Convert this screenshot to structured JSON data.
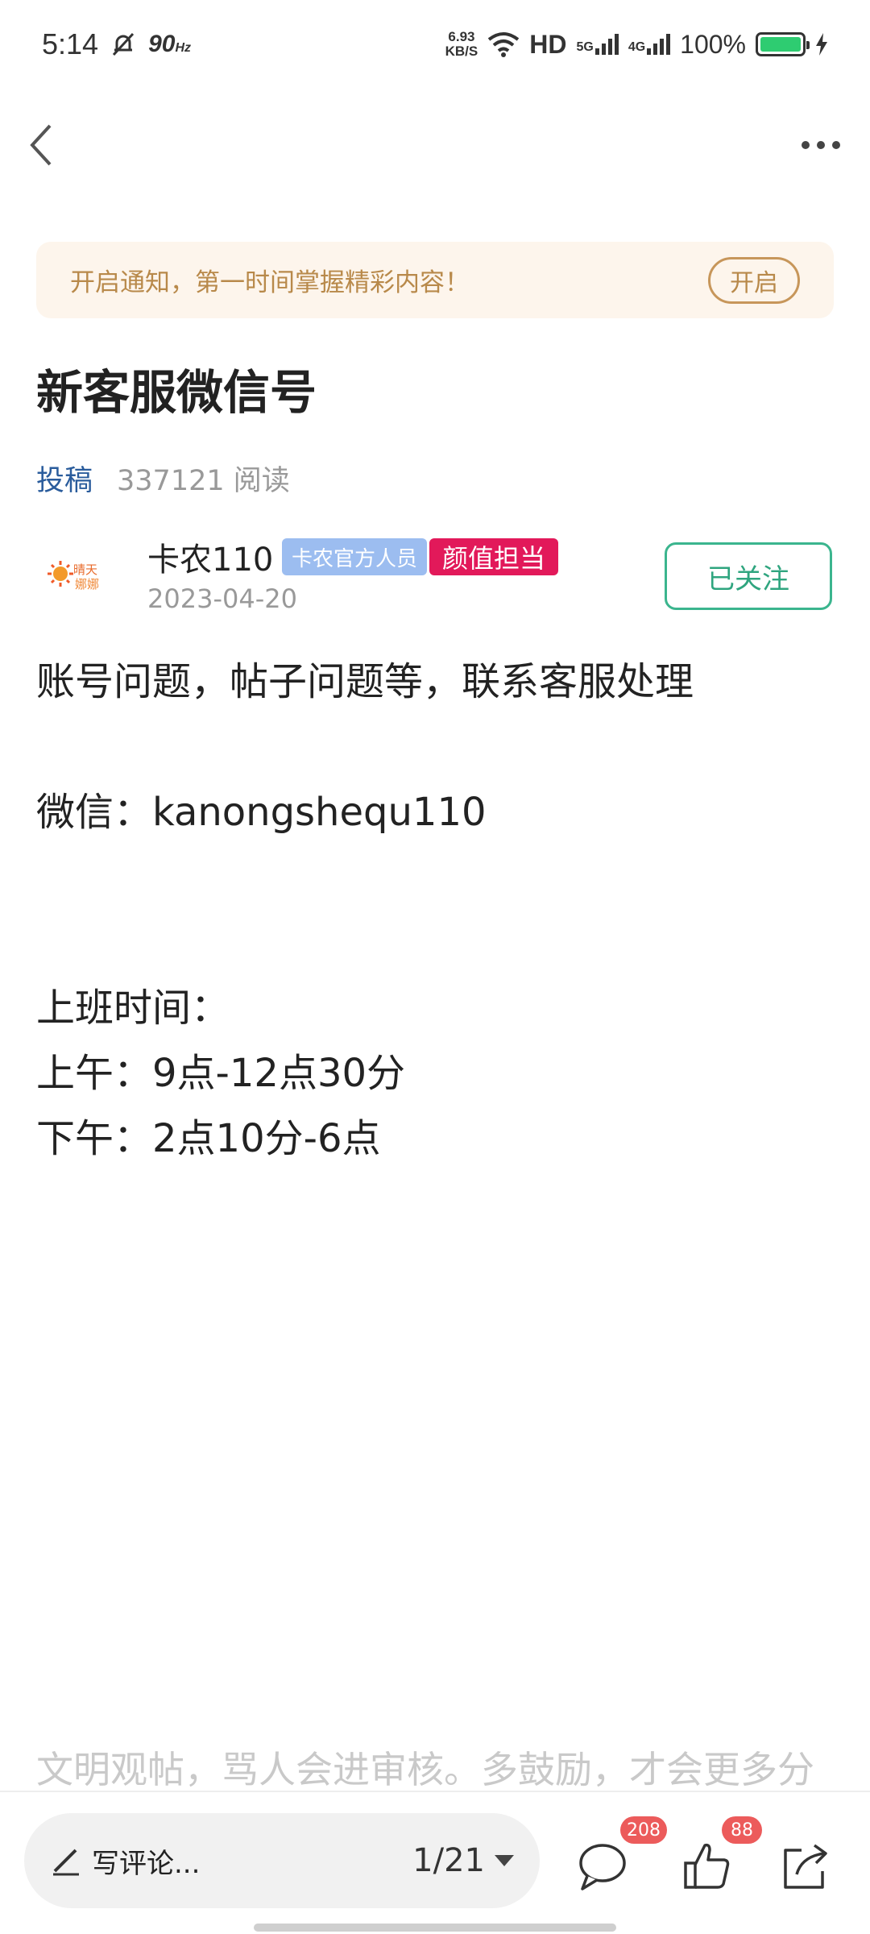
{
  "status_bar": {
    "time": "5:14",
    "refresh": "90",
    "refresh_unit": "Hz",
    "speed_value": "6.93",
    "speed_unit": "KB/S",
    "hd": "HD",
    "net1": "5G",
    "net2": "4G",
    "battery": "100%"
  },
  "notify": {
    "text": "开启通知，第一时间掌握精彩内容！",
    "button": "开启"
  },
  "post": {
    "title": "新客服微信号",
    "category": "投稿",
    "reads": "337121 阅读"
  },
  "author": {
    "name": "卡农110",
    "badge_official": "卡农官方人员",
    "badge_looks": "颜值担当",
    "date": "2023-04-20",
    "follow": "已关注",
    "avatar_text_top": "晴天",
    "avatar_text_bottom": "娜娜"
  },
  "content": {
    "line1": "账号问题，帖子问题等，联系客服处理",
    "line2": "微信：kanongshequ110",
    "line3": "上班时间：",
    "line4": "上午：9点-12点30分",
    "line5": "下午：2点10分-6点"
  },
  "faded_text": "文明观帖，骂人会进审核。多鼓励，才会更多分",
  "bottom_bar": {
    "comment_placeholder": "写评论...",
    "page_indicator": "1/21",
    "comment_count": "208",
    "like_count": "88"
  },
  "colors": {
    "accent_green": "#3bb58e",
    "badge_red": "#e2195a",
    "badge_blue": "#9cbdf0",
    "notify_bg": "#fdf5ec",
    "notify_text": "#b8894a"
  }
}
